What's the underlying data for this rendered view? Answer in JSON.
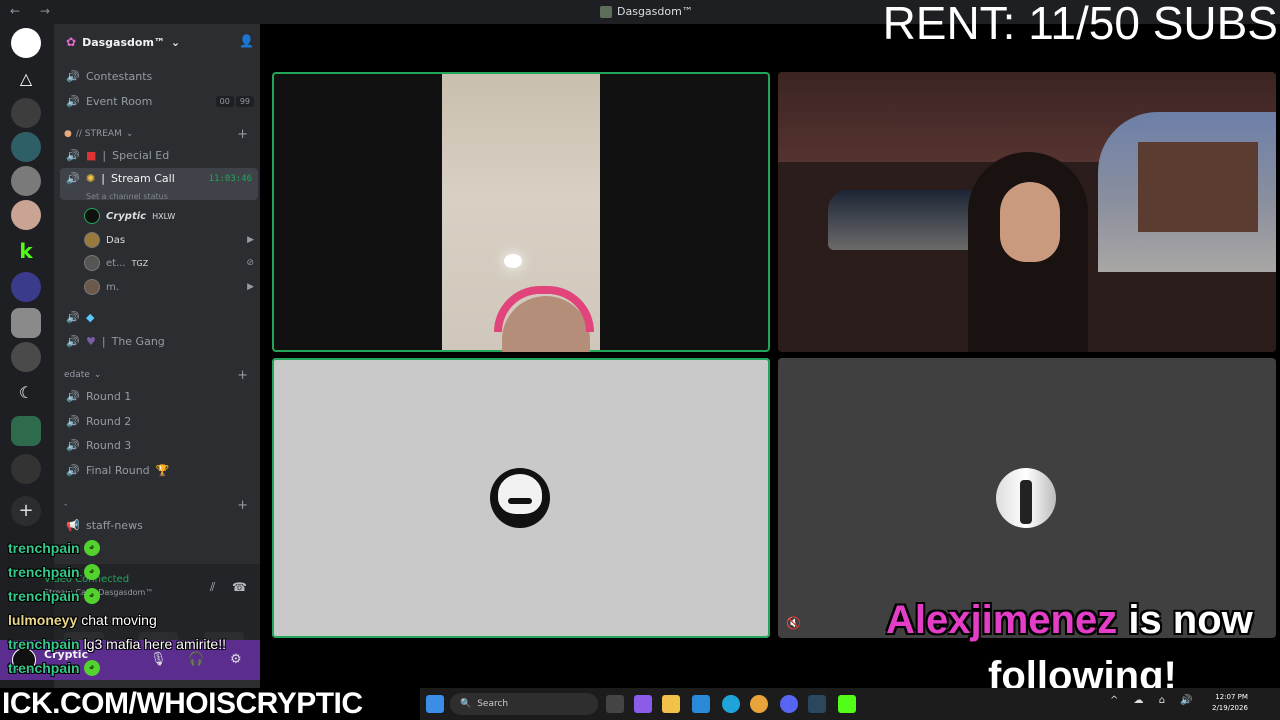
{
  "window": {
    "title": "Dasgasdom™",
    "nav": "← →"
  },
  "overlay": {
    "rent_text": "RENT: 11/50 SUBS",
    "banner": "ICK.COM/WHOISCRYPTIC",
    "follow_name": "Alexjimenez",
    "follow_rest": " is now",
    "follow_line2": "following!"
  },
  "sidebar": {
    "guild_name": "Dasgasdom™",
    "channels_top": [
      {
        "label": "Contestants"
      },
      {
        "label": "Event Room",
        "badge_a": "00",
        "badge_b": "99"
      }
    ],
    "category_stream": "// STREAM",
    "stream_channels": {
      "special_ed": "Special Ed",
      "stream_call": "Stream Call",
      "timer": "11:03:46",
      "status_hint": "Set a channel status"
    },
    "members": [
      {
        "name": "Cryptic",
        "tag": "HXLW"
      },
      {
        "name": "Das"
      },
      {
        "name": "et...",
        "tag": "TGZ"
      },
      {
        "name": "m."
      }
    ],
    "the_gang": "The Gang",
    "category_edate": "edate",
    "rounds": [
      "Round 1",
      "Round 2",
      "Round 3",
      "Final Round"
    ],
    "category_misc": "-",
    "staff_news": "staff-news",
    "voice": {
      "status": "Video Connected",
      "location": "Stream Call / Dasgasdom™"
    },
    "user": {
      "name": "Cryptic"
    }
  },
  "chat": [
    {
      "user": "trenchpain",
      "text": "",
      "emote": true
    },
    {
      "user": "trenchpain",
      "text": "",
      "emote": true
    },
    {
      "user": "trenchpain",
      "text": "",
      "emote": true
    },
    {
      "user": "lulmoneyy",
      "text": "chat moving",
      "emote": false
    },
    {
      "user": "trenchpain",
      "text": "lg3 mafia here amirite!!",
      "emote": false
    },
    {
      "user": "trenchpain",
      "text": "",
      "emote": true
    }
  ],
  "taskbar": {
    "search_placeholder": "Search",
    "time": "12:07 PM",
    "date": "2/19/2026"
  },
  "colors": {
    "speaking": "#23a55a",
    "follow_name": "#e43ec8",
    "chat_user": "#34c98a",
    "userbar": "#5b2d8e"
  }
}
